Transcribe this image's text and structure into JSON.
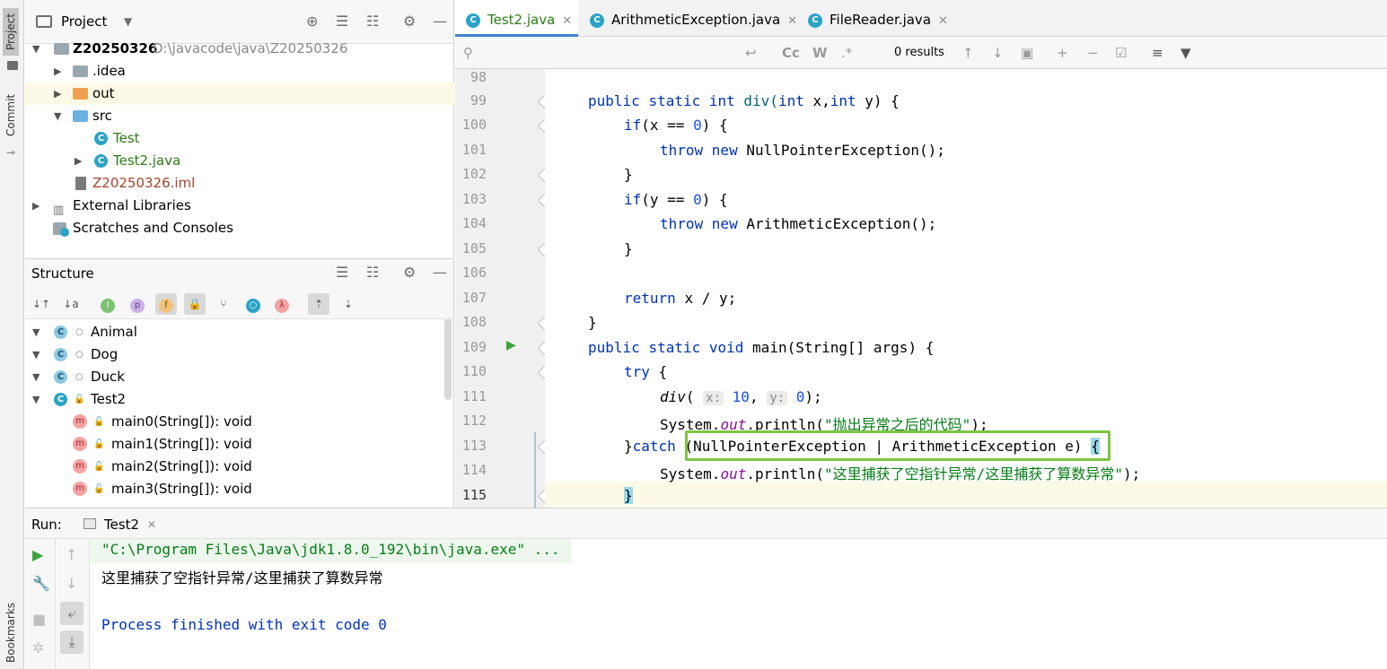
{
  "side_tabs": {
    "project": "Project",
    "commit": "Commit",
    "bookmarks": "Bookmarks"
  },
  "project_panel": {
    "title": "Project",
    "tree": [
      {
        "label": "Z20250326",
        "path": "D:\\javacode\\java\\Z20250326"
      },
      {
        "label": ".idea"
      },
      {
        "label": "out"
      },
      {
        "label": "src"
      },
      {
        "label": "Test"
      },
      {
        "label": "Test2.java"
      },
      {
        "label": "Z20250326.iml"
      },
      {
        "label": "External Libraries"
      },
      {
        "label": "Scratches and Consoles"
      }
    ]
  },
  "structure_panel": {
    "title": "Structure",
    "items": [
      {
        "label": "Animal"
      },
      {
        "label": "Dog"
      },
      {
        "label": "Duck"
      },
      {
        "label": "Test2"
      },
      {
        "label": "main0(String[]): void"
      },
      {
        "label": "main1(String[]): void"
      },
      {
        "label": "main2(String[]): void"
      },
      {
        "label": "main3(String[]): void"
      }
    ]
  },
  "editor": {
    "tabs": [
      {
        "label": "Test2.java",
        "active": true
      },
      {
        "label": "ArithmeticException.java",
        "active": false
      },
      {
        "label": "FileReader.java",
        "active": false
      }
    ],
    "search": {
      "placeholder": "",
      "results": "0 results",
      "cc": "Cc",
      "w": "W",
      "regex": ".*"
    },
    "lines": [
      {
        "n": "98"
      },
      {
        "n": "99",
        "t1": "public ",
        "t2": "static ",
        "t3": "int ",
        "t4": "div(",
        "t5": "int ",
        "t6": "x,",
        "t7": "int ",
        "t8": "y) {"
      },
      {
        "n": "100",
        "t1": "if",
        "t2": "(x == ",
        "t3": "0",
        "t4": ") {"
      },
      {
        "n": "101",
        "t1": "throw ",
        "t2": "new ",
        "t3": "NullPointerException();"
      },
      {
        "n": "102",
        "t1": "}"
      },
      {
        "n": "103",
        "t1": "if",
        "t2": "(y == ",
        "t3": "0",
        "t4": ") {"
      },
      {
        "n": "104",
        "t1": "throw ",
        "t2": "new ",
        "t3": "ArithmeticException();"
      },
      {
        "n": "105",
        "t1": "}"
      },
      {
        "n": "106"
      },
      {
        "n": "107",
        "t1": "return ",
        "t2": "x / y;"
      },
      {
        "n": "108",
        "t1": "}"
      },
      {
        "n": "109",
        "t1": "public ",
        "t2": "static ",
        "t3": "void ",
        "t4": "main(String[] args) {"
      },
      {
        "n": "110",
        "t1": "try ",
        "t2": "{"
      },
      {
        "n": "111",
        "t1": "div",
        "t2": "( ",
        "h1": "x:",
        "t3": " 10",
        "t4": ", ",
        "h2": "y:",
        "t5": " 0",
        "t6": ");"
      },
      {
        "n": "112",
        "t1": "System.",
        "t2": "out",
        "t3": ".println(",
        "t4": "\"抛出异常之后的代码\"",
        "t5": ");"
      },
      {
        "n": "113",
        "t1": "}",
        "t2": "catch ",
        "t3": "(NullPointerException | ArithmeticException e) ",
        "t4": "{"
      },
      {
        "n": "114",
        "t1": "System.",
        "t2": "out",
        "t3": ".println(",
        "t4": "\"这里捕获了空指针异常/这里捕获了算数异常\"",
        "t5": ");"
      },
      {
        "n": "115",
        "t1": "}"
      }
    ]
  },
  "run_panel": {
    "label": "Run:",
    "tab": "Test2",
    "output": [
      "\"C:\\Program Files\\Java\\jdk1.8.0_192\\bin\\java.exe\" ...",
      "这里捕获了空指针异常/这里捕获了算数异常",
      "",
      "Process finished with exit code 0"
    ]
  },
  "colors": {
    "accent": "#4083c9",
    "highlight_box": "#7dc443",
    "keyword": "#0033b3",
    "string": "#067d17",
    "caret_line": "#fcfae6"
  }
}
